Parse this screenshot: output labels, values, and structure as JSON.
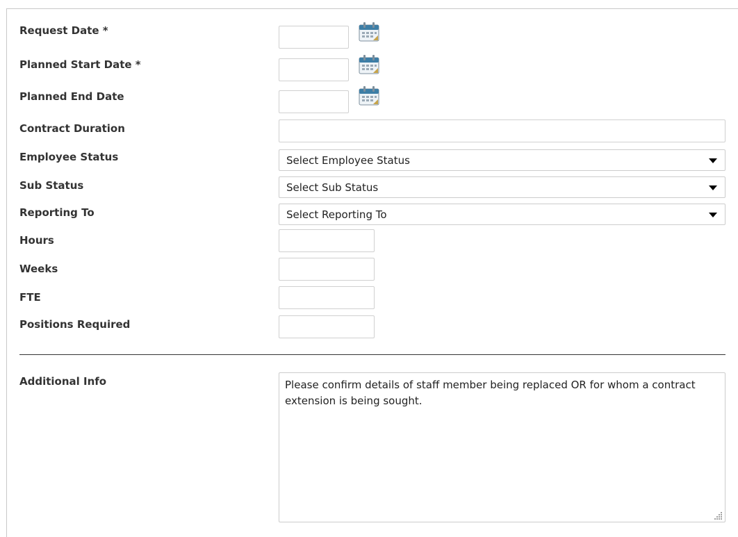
{
  "form": {
    "fields": {
      "request_date": {
        "label": "Request Date *",
        "value": ""
      },
      "planned_start_date": {
        "label": "Planned Start Date *",
        "value": ""
      },
      "planned_end_date": {
        "label": "Planned End Date",
        "value": ""
      },
      "contract_duration": {
        "label": "Contract Duration",
        "value": ""
      },
      "employee_status": {
        "label": "Employee Status",
        "selected": "Select Employee Status"
      },
      "sub_status": {
        "label": "Sub Status",
        "selected": "Select Sub Status"
      },
      "reporting_to": {
        "label": "Reporting To",
        "selected": "Select Reporting To"
      },
      "hours": {
        "label": "Hours",
        "value": ""
      },
      "weeks": {
        "label": "Weeks",
        "value": ""
      },
      "fte": {
        "label": "FTE",
        "value": ""
      },
      "positions_required": {
        "label": "Positions Required",
        "value": ""
      }
    },
    "additional_info": {
      "label": "Additional Info",
      "value": "Please confirm details of staff member being replaced OR for whom a contract extension is being sought."
    }
  },
  "icons": {
    "calendar": "calendar-icon",
    "dropdown": "caret-down-icon",
    "resize": "resize-grip-icon"
  },
  "colors": {
    "label_text": "#333333",
    "input_border": "#d0d0d0",
    "divider": "#333333",
    "calendar_blue": "#3d7ea6"
  }
}
